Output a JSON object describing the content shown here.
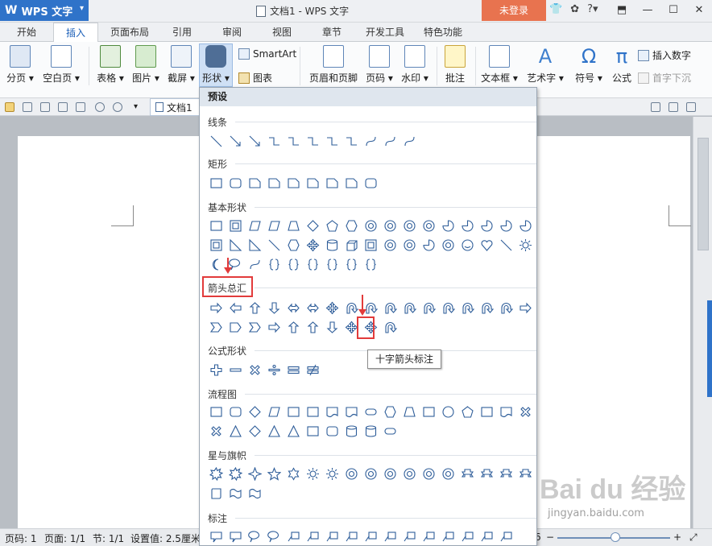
{
  "titlebar": {
    "app_name": "WPS 文字",
    "doc_title": "文档1 - WPS 文字",
    "login_label": "未登录",
    "help_label": "?"
  },
  "tabs": [
    "开始",
    "插入",
    "页面布局",
    "引用",
    "审阅",
    "视图",
    "章节",
    "开发工具",
    "特色功能"
  ],
  "active_tab": "插入",
  "ribbon": {
    "page_break": "分页",
    "blank_page": "空白页",
    "table": "表格",
    "picture": "图片",
    "screenshot": "截屏",
    "shapes": "形状",
    "smartart": "SmartArt",
    "chart": "图表",
    "header_footer": "页眉和页脚",
    "page_number": "页码",
    "watermark": "水印",
    "comment": "批注",
    "textbox": "文本框",
    "wordart": "艺术字",
    "symbol": "符号",
    "formula": "公式",
    "insert_number": "插入数字",
    "drop_cap": "首字下沉"
  },
  "document_tab": "文档1",
  "shapes_panel": {
    "preset": "预设",
    "sections": [
      "线条",
      "矩形",
      "基本形状",
      "箭头总汇",
      "公式形状",
      "流程图",
      "星与旗帜",
      "标注"
    ],
    "tooltip": "十字箭头标注"
  },
  "statusbar": {
    "page_code": "页码: 1",
    "page": "页面: 1/1",
    "section": "节: 1/1",
    "setting": "设置值: 2.5厘米",
    "zoom_suffix": "6"
  },
  "watermark": {
    "brand": "Bai du 经验",
    "url": "jingyan.baidu.com"
  },
  "colors": {
    "accent": "#2f73c9",
    "login": "#e8734f",
    "highlight": "#e23b3b",
    "shape_stroke": "#2e5d99"
  }
}
